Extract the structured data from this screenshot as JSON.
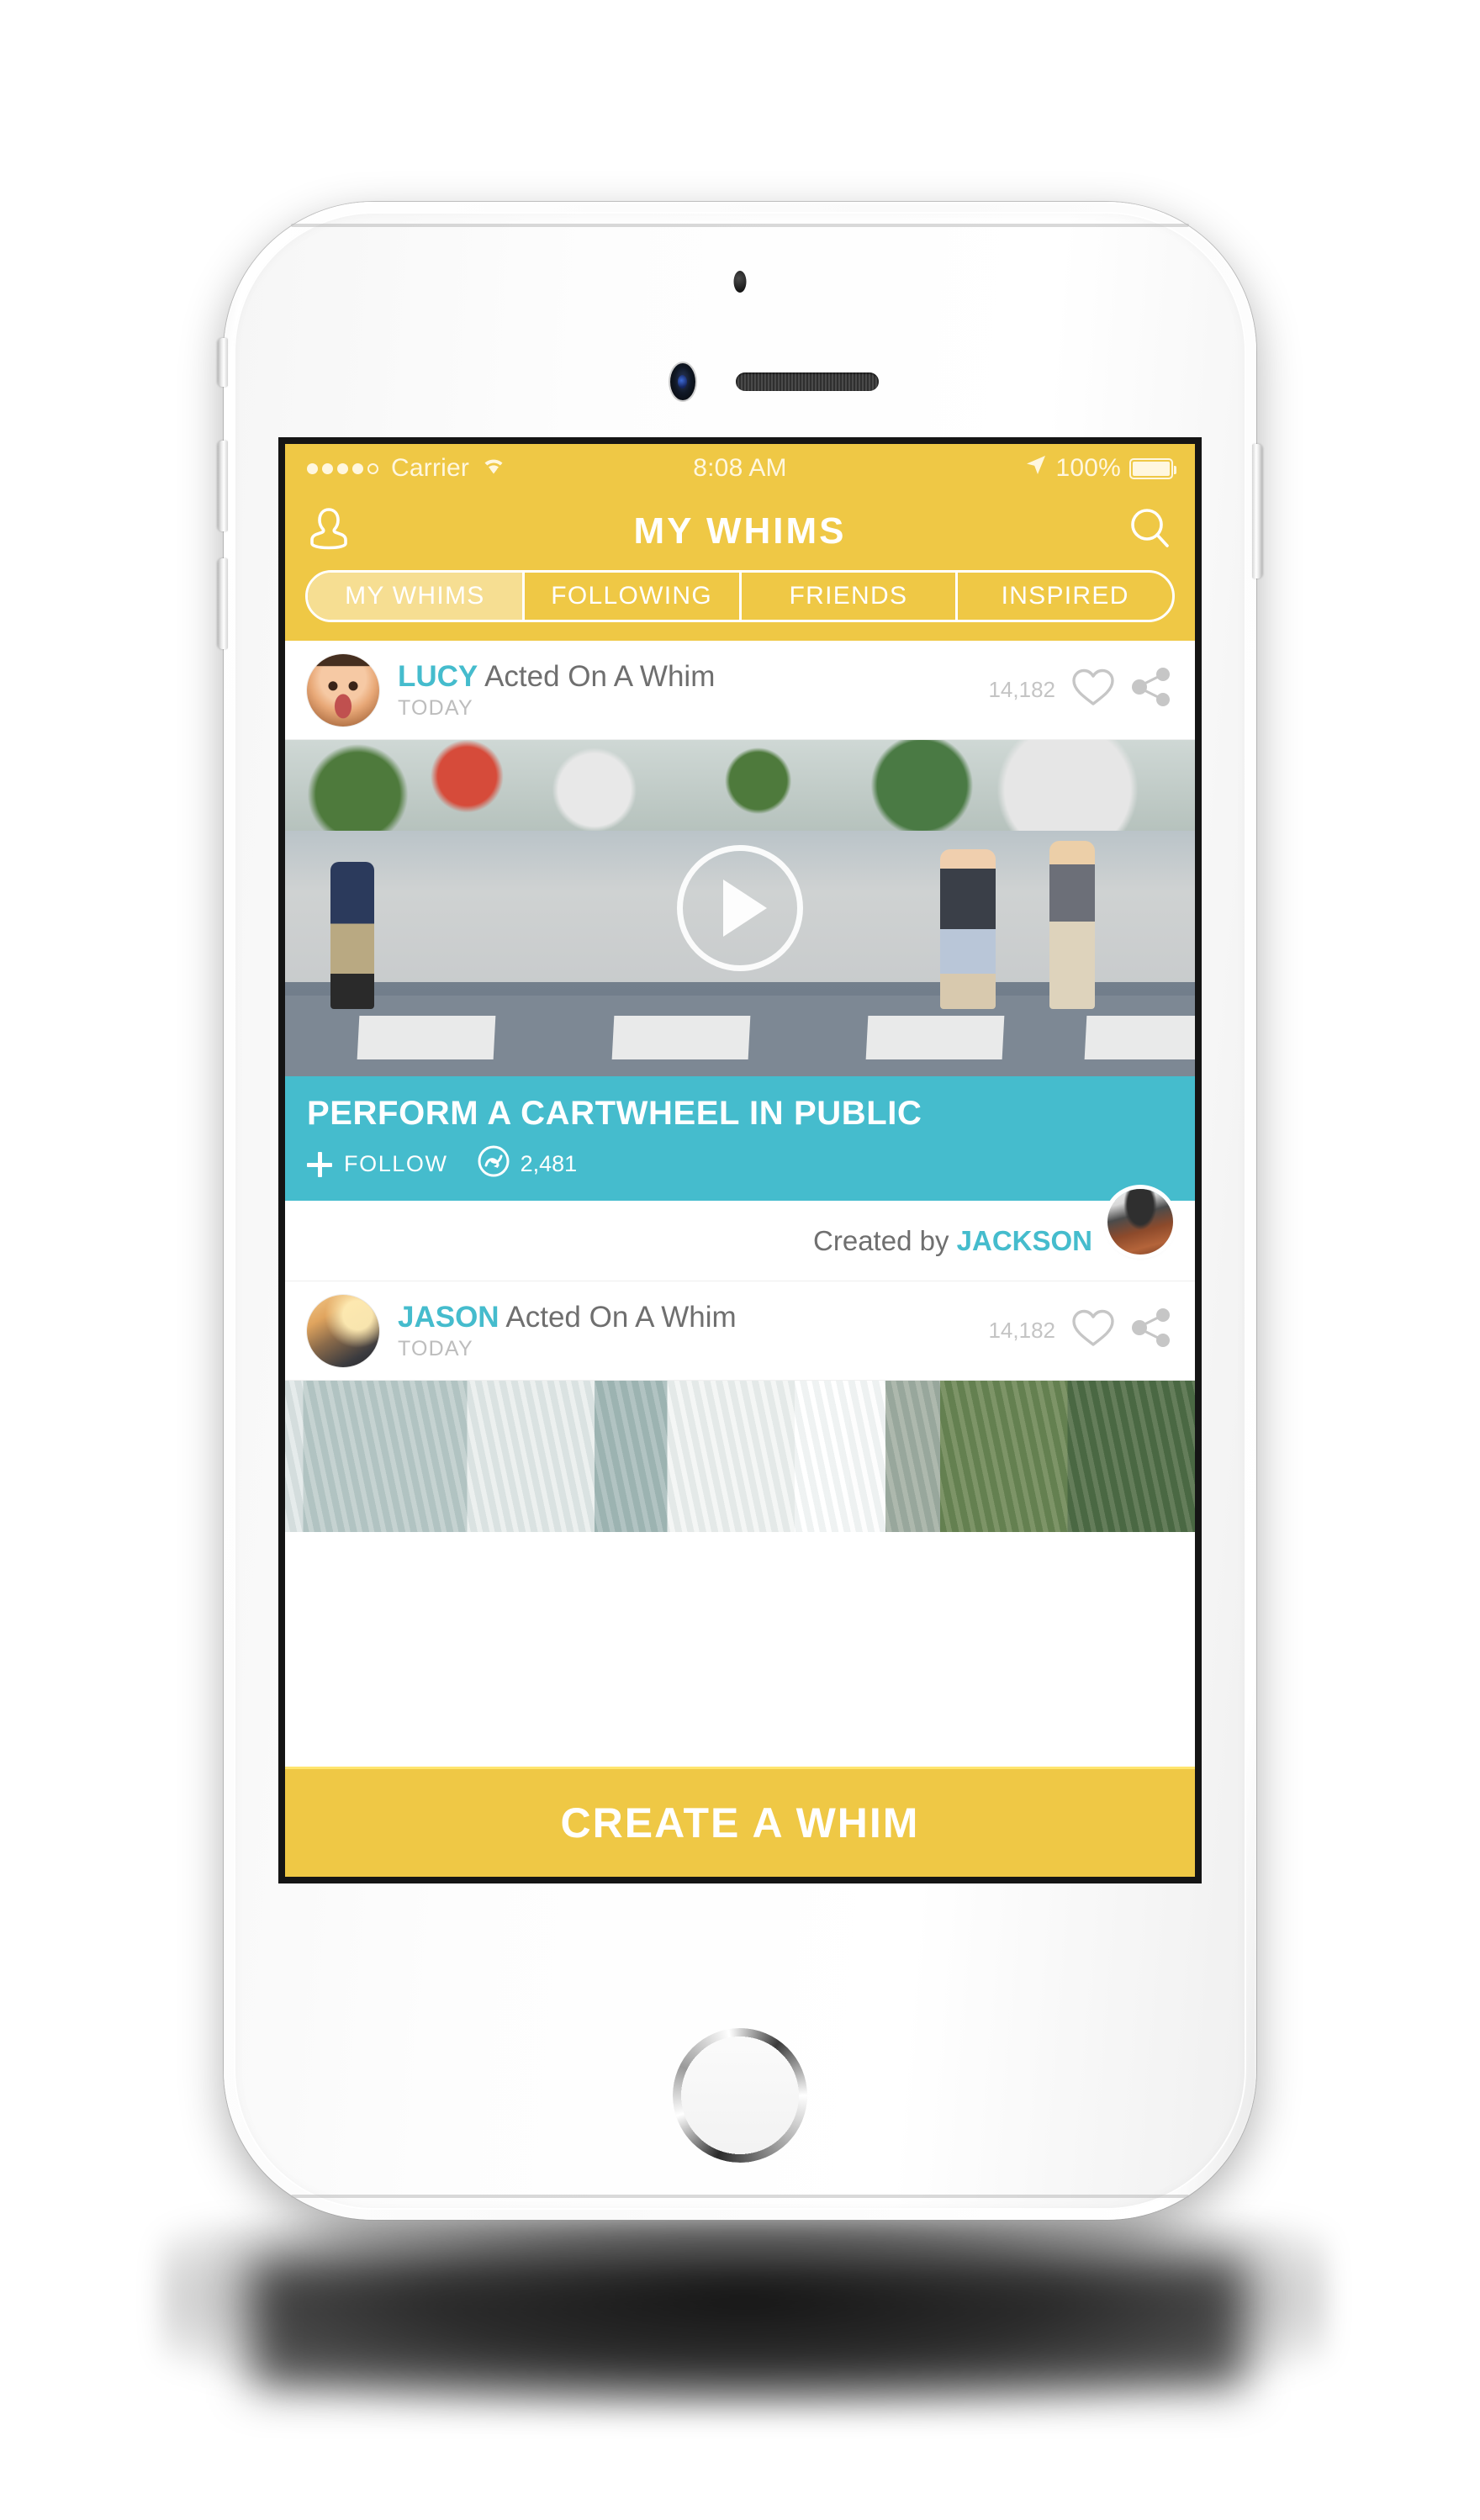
{
  "status_bar": {
    "signal_dots_filled": 4,
    "signal_dots_total": 5,
    "carrier": "Carrier",
    "wifi_icon": "wifi-icon",
    "time": "8:08 AM",
    "location_icon": "location-arrow-icon",
    "battery_percent": "100%",
    "battery_icon": "battery-full-icon"
  },
  "nav": {
    "profile_icon": "profile-icon",
    "title": "MY WHIMS",
    "search_icon": "search-icon"
  },
  "tabs": [
    {
      "label": "MY WHIMS",
      "active": true
    },
    {
      "label": "FOLLOWING",
      "active": false
    },
    {
      "label": "FRIENDS",
      "active": false
    },
    {
      "label": "INSPIRED",
      "active": false
    }
  ],
  "feed": {
    "posts": [
      {
        "user": "LUCY",
        "action": "Acted On A Whim",
        "time": "TODAY",
        "like_count": "14,182",
        "heart_icon": "heart-outline-icon",
        "share_icon": "share-icon",
        "media_type": "video",
        "play_icon": "play-icon",
        "whim": {
          "title": "PERFORM A CARTWHEEL IN PUBLIC",
          "follow_label": "FOLLOW",
          "follow_icon": "plus-icon",
          "whim_icon": "whim-circle-arrow-icon",
          "whim_count": "2,481",
          "created_prefix": "Created by",
          "created_by": "JACKSON"
        }
      },
      {
        "user": "JASON",
        "action": "Acted On A Whim",
        "time": "TODAY",
        "like_count": "14,182",
        "heart_icon": "heart-outline-icon",
        "share_icon": "share-icon",
        "media_type": "photo"
      }
    ]
  },
  "cta": {
    "label": "CREATE A WHIM"
  },
  "colors": {
    "brand_yellow": "#EFC845",
    "brand_yellow_light": "#F6DE92",
    "brand_teal": "#45BCCD",
    "status_text": "#FFF7DF",
    "body_text": "#6F6F6F",
    "muted_text": "#BDBDBD"
  }
}
